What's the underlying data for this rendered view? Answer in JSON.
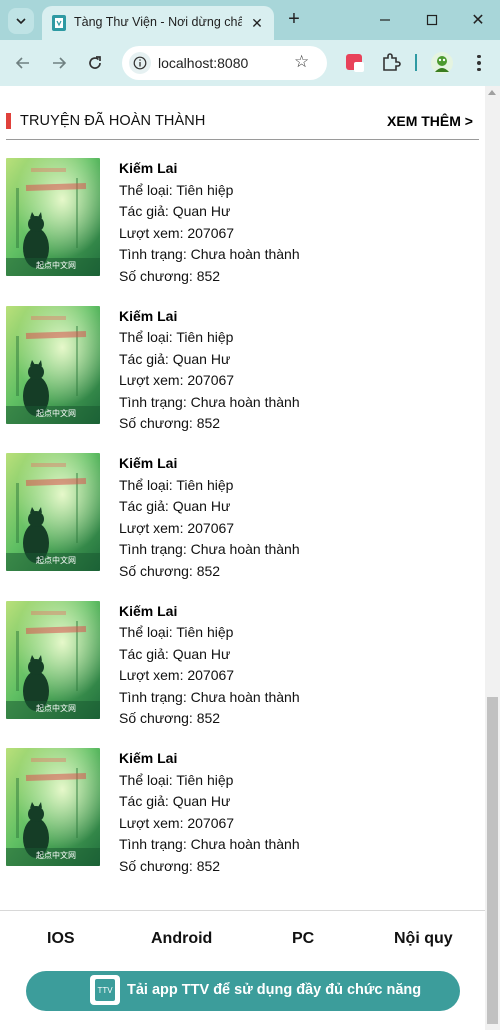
{
  "browser": {
    "tab_title": "Tàng Thư Viện - Nơi dừng chân",
    "url": "localhost:8080",
    "colors": {
      "frame": "#a8d6d9",
      "toolbar": "#d9eff0",
      "accent": "#2e9aa3"
    },
    "icons": [
      "tab-search-icon",
      "favicon-icon",
      "close-icon",
      "plus-icon",
      "minimize-icon",
      "maximize-icon",
      "back-icon",
      "forward-icon",
      "reload-icon",
      "site-info-icon",
      "star-icon",
      "extension-icon",
      "puzzle-icon",
      "profile-icon",
      "kebab-menu-icon"
    ]
  },
  "section": {
    "title": "TRUYỆN ĐÃ HOÀN THÀNH",
    "see_more": "XEM THÊM >",
    "accent_color": "#e0413b"
  },
  "stories": [
    {
      "name": "Kiếm Lai",
      "genre": "Thể loại: Tiên hiệp",
      "author": "Tác giả: Quan Hư",
      "views": "Lượt xem: 207067",
      "status": "Tình trạng: Chưa hoàn thành",
      "chapters": "Số chương: 852",
      "cover_caption": "起点中文网"
    },
    {
      "name": "Kiếm Lai",
      "genre": "Thể loại: Tiên hiệp",
      "author": "Tác giả: Quan Hư",
      "views": "Lượt xem: 207067",
      "status": "Tình trạng: Chưa hoàn thành",
      "chapters": "Số chương: 852",
      "cover_caption": "起点中文网"
    },
    {
      "name": "Kiếm Lai",
      "genre": "Thể loại: Tiên hiệp",
      "author": "Tác giả: Quan Hư",
      "views": "Lượt xem: 207067",
      "status": "Tình trạng: Chưa hoàn thành",
      "chapters": "Số chương: 852",
      "cover_caption": "起点中文网"
    },
    {
      "name": "Kiếm Lai",
      "genre": "Thể loại: Tiên hiệp",
      "author": "Tác giả: Quan Hư",
      "views": "Lượt xem: 207067",
      "status": "Tình trạng: Chưa hoàn thành",
      "chapters": "Số chương: 852",
      "cover_caption": "起点中文网"
    },
    {
      "name": "Kiếm Lai",
      "genre": "Thể loại: Tiên hiệp",
      "author": "Tác giả: Quan Hư",
      "views": "Lượt xem: 207067",
      "status": "Tình trạng: Chưa hoàn thành",
      "chapters": "Số chương: 852",
      "cover_caption": "起点中文网"
    }
  ],
  "footer": {
    "links": [
      "IOS",
      "Android",
      "PC",
      "Nội quy"
    ],
    "banner_text": "Tải app TTV để sử dụng đầy đủ chức năng",
    "banner_color": "#3c9d9b",
    "logo_text": "TTV"
  }
}
